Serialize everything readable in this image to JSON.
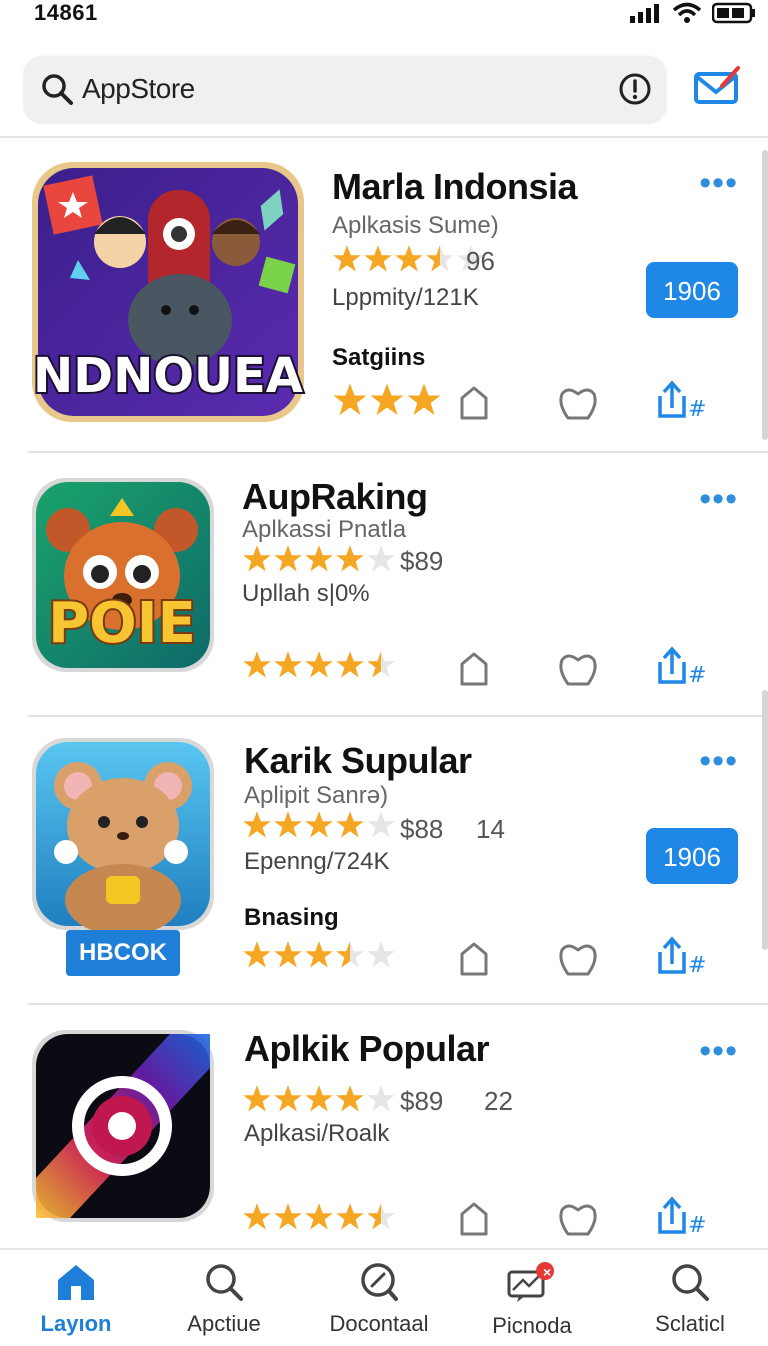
{
  "status": {
    "time": "14861"
  },
  "search": {
    "query": "AppStore"
  },
  "apps": [
    {
      "name": "Marla Indonsia",
      "subtitle": "Aplkasis Sume)",
      "rating": 3.5,
      "rating_label": "96",
      "meta": "Lppmity/121K",
      "section": "Satgiins",
      "section_rating": 3,
      "button": "1906",
      "icon_text": "NDNOUEA",
      "more": "•••"
    },
    {
      "name": "AupRaking",
      "subtitle": "Aplkassi Pnatla",
      "rating": 4,
      "price": "$89",
      "meta": "Upllah s|0%",
      "section_rating": 4.5,
      "icon_text": "POIE",
      "more": "•••"
    },
    {
      "name": "Karik Supular",
      "subtitle": "Aplipit Sanrǝ)",
      "rating": 4,
      "price": "$88",
      "count": "14",
      "meta": "Epenng/724K",
      "section": "Bnasing",
      "section_rating": 3.5,
      "button": "1906",
      "badge": "HBCOK",
      "more": "•••"
    },
    {
      "name": "Aplkik Popular",
      "rating": 4,
      "price": "$89",
      "count": "22",
      "meta": "Aplkasi/Roalk",
      "section_rating": 4.5,
      "more": "•••"
    }
  ],
  "tabs": [
    {
      "label": "Layıon",
      "icon": "home-icon",
      "active": true
    },
    {
      "label": "Apctiue",
      "icon": "search-icon"
    },
    {
      "label": "Docontaal",
      "icon": "search-edit-icon"
    },
    {
      "label": "Picnoda",
      "icon": "message-icon",
      "badge": "×"
    },
    {
      "label": "Sclaticl",
      "icon": "search-icon"
    }
  ],
  "colors": {
    "accent": "#1f87e5",
    "star": "#f5a623",
    "star_empty": "#e6e6e6"
  }
}
